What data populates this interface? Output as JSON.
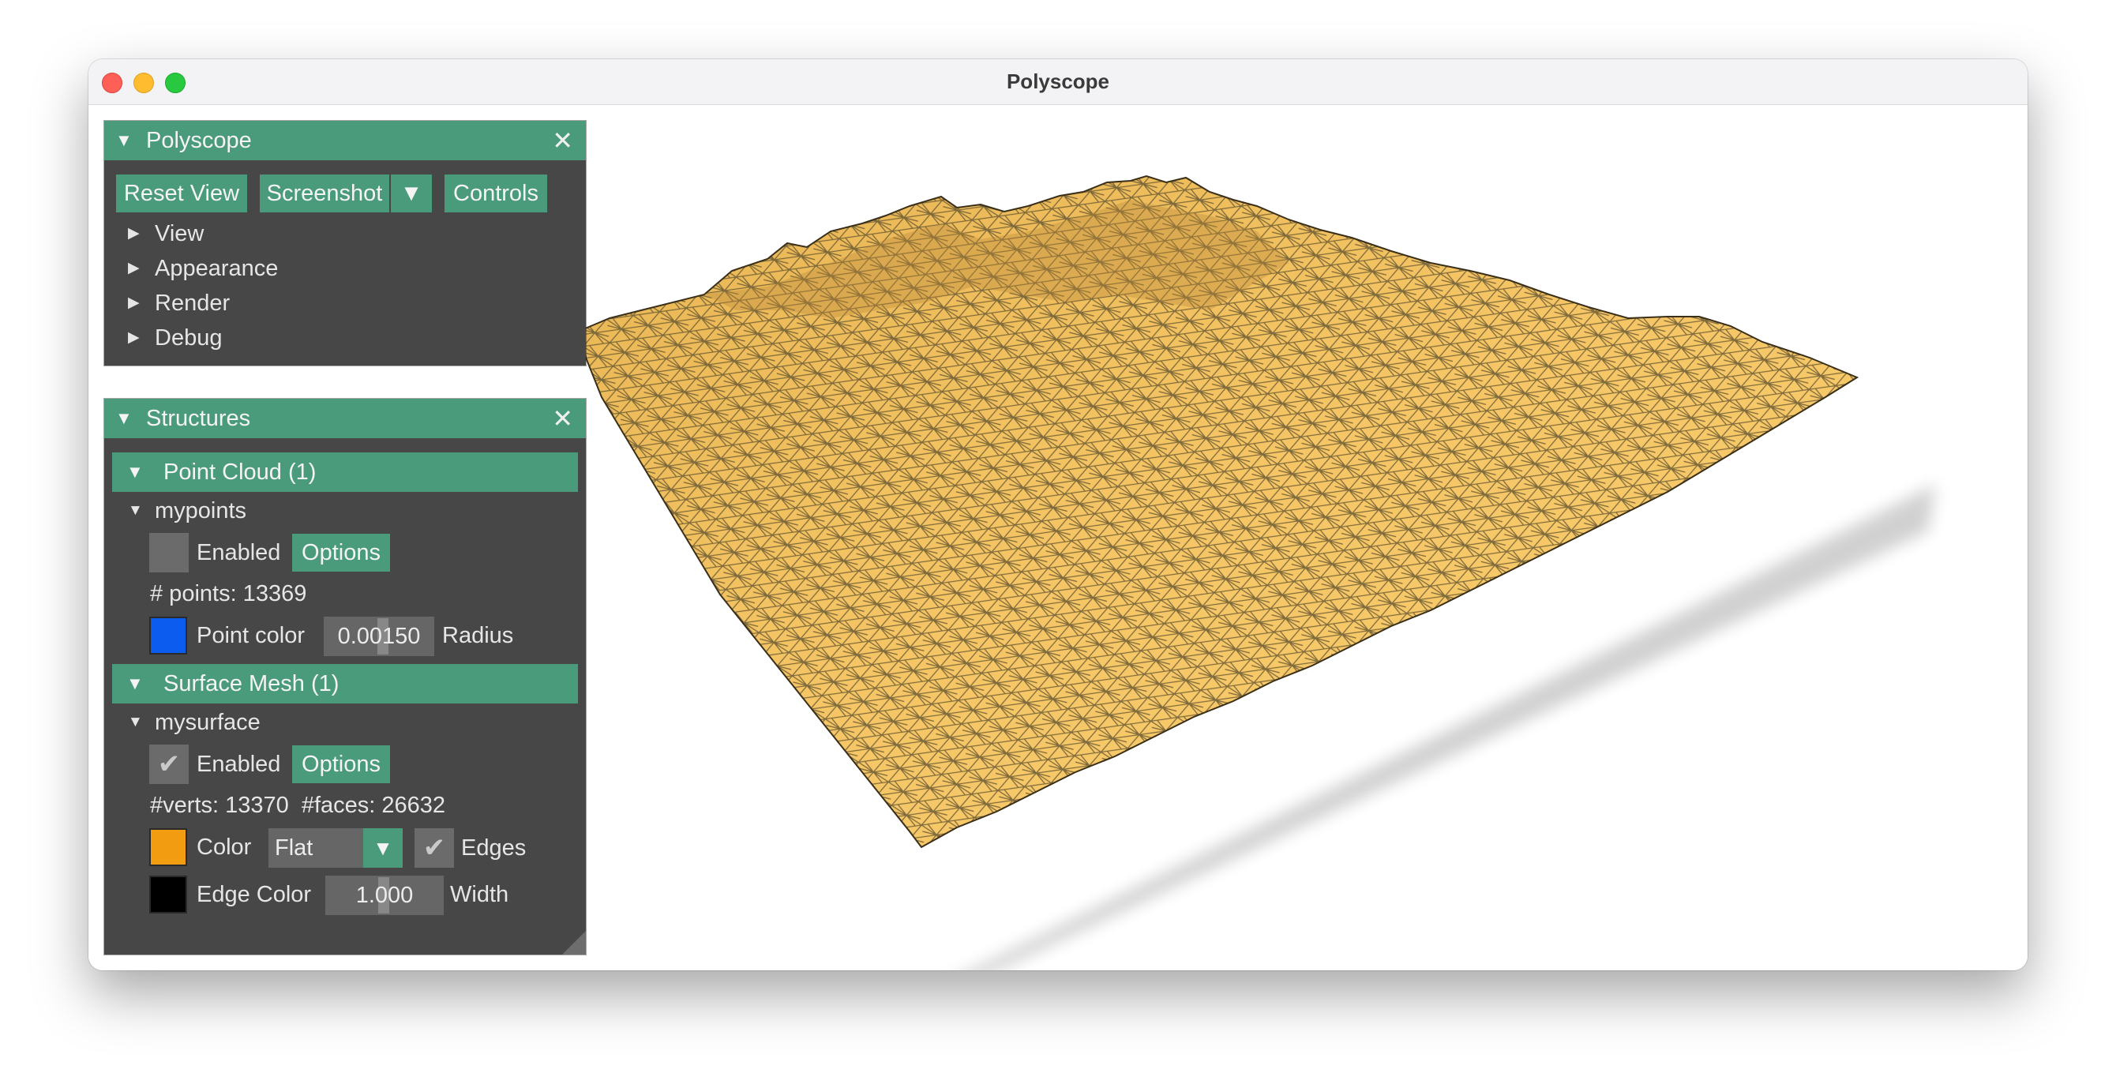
{
  "window": {
    "title": "Polyscope"
  },
  "polyscope_panel": {
    "title": "Polyscope",
    "buttons": {
      "reset_view": "Reset View",
      "screenshot": "Screenshot",
      "controls": "Controls"
    },
    "menu": [
      "View",
      "Appearance",
      "Render",
      "Debug"
    ]
  },
  "structures_panel": {
    "title": "Structures",
    "point_cloud": {
      "section_label": "Point Cloud (1)",
      "name": "mypoints",
      "enabled_label": "Enabled",
      "enabled": false,
      "options_label": "Options",
      "points_info": "# points: 13369",
      "point_color_label": "Point color",
      "point_color": "#0d5cf0",
      "radius_value": "0.00150",
      "radius_label": "Radius"
    },
    "surface_mesh": {
      "section_label": "Surface Mesh (1)",
      "name": "mysurface",
      "enabled_label": "Enabled",
      "enabled": true,
      "options_label": "Options",
      "info": "#verts: 13370  #faces: 26632",
      "color_label": "Color",
      "color": "#f29c12",
      "shade_style": "Flat",
      "edges_label": "Edges",
      "edges_enabled": true,
      "edge_color_label": "Edge Color",
      "edge_color": "#000000",
      "width_value": "1.000",
      "width_label": "Width"
    }
  },
  "colors": {
    "accent": "#4a9a7c",
    "panel_bg": "#474747",
    "mesh_fill": "#f4c463",
    "mesh_edge": "#5a4a2a"
  },
  "icons": {
    "collapse": "triangle-down-icon",
    "expand": "triangle-right-icon",
    "close": "close-icon",
    "check": "checkmark-icon",
    "dropdown": "chevron-down-icon"
  }
}
